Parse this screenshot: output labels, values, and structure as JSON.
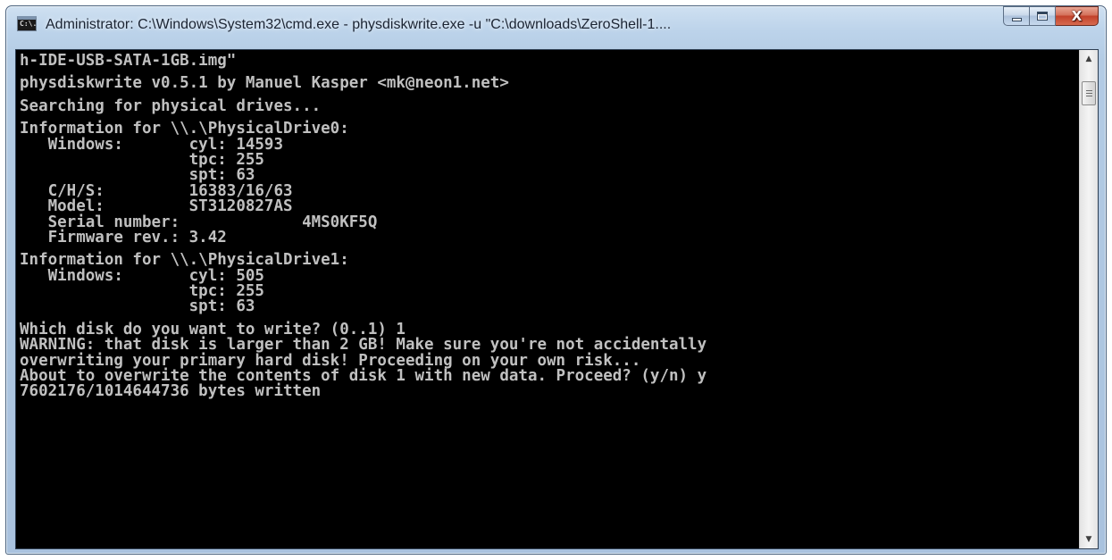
{
  "window": {
    "title": "Administrator: C:\\Windows\\System32\\cmd.exe - physdiskwrite.exe  -u \"C:\\downloads\\ZeroShell-1....",
    "icon_label": "C:\\.",
    "icon": "console-app-icon"
  },
  "caption_buttons": {
    "minimize_icon": "minimize-icon",
    "maximize_icon": "maximize-icon",
    "close_glyph": "X"
  },
  "console": {
    "lines": [
      "h-IDE-USB-SATA-1GB.img\"",
      "",
      "physdiskwrite v0.5.1 by Manuel Kasper <mk@neon1.net>",
      "",
      "Searching for physical drives...",
      "",
      "Information for \\\\.\\PhysicalDrive0:",
      "   Windows:       cyl: 14593",
      "                  tpc: 255",
      "                  spt: 63",
      "   C/H/S:         16383/16/63",
      "   Model:         ST3120827AS",
      "   Serial number:             4MS0KF5Q",
      "   Firmware rev.: 3.42",
      "",
      "Information for \\\\.\\PhysicalDrive1:",
      "   Windows:       cyl: 505",
      "                  tpc: 255",
      "                  spt: 63",
      "",
      "Which disk do you want to write? (0..1) 1",
      "WARNING: that disk is larger than 2 GB! Make sure you're not accidentally",
      "overwriting your primary hard disk! Proceeding on your own risk...",
      "About to overwrite the contents of disk 1 with new data. Proceed? (y/n) y",
      "7602176/1014644736 bytes written"
    ],
    "foreground": "#c0c0c0",
    "background": "#000000"
  },
  "scrollbar": {
    "up_arrow": "▲",
    "down_arrow": "▼"
  },
  "colors": {
    "close_button": "#c2412a",
    "frame": "#b3cbe4"
  }
}
